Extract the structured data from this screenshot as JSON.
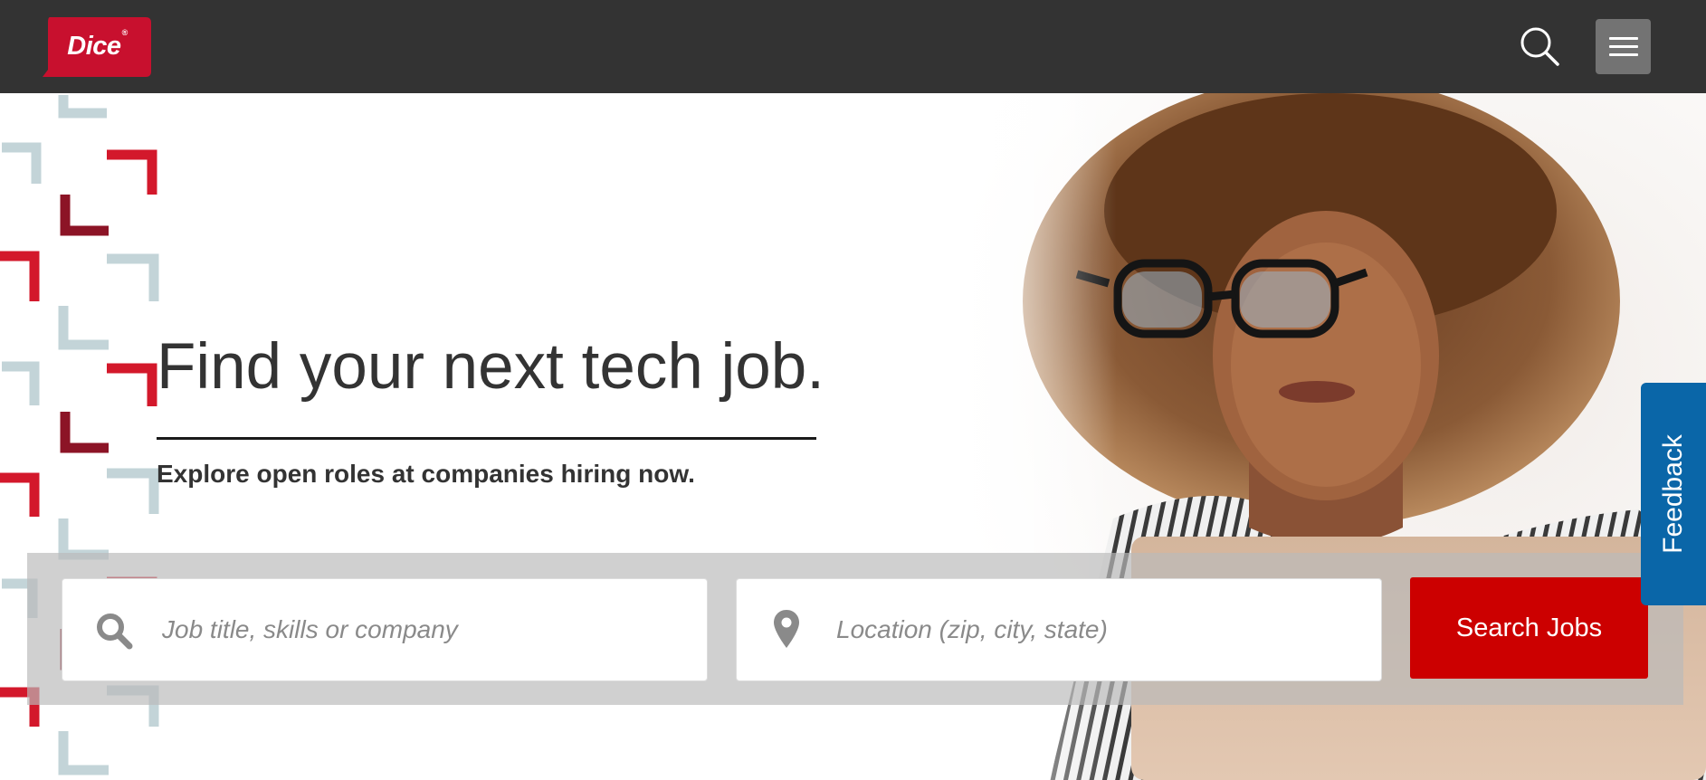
{
  "brand": {
    "logo_text": "Dice",
    "logo_mark": "®",
    "color": "#c8102e"
  },
  "nav": {
    "search_icon": "search-icon",
    "menu_icon": "hamburger-menu-icon"
  },
  "hero": {
    "headline": "Find your next tech job.",
    "subheadline": "Explore open roles at companies hiring now."
  },
  "search": {
    "job_placeholder": "Job title, skills or company",
    "job_icon": "search-icon",
    "location_placeholder": "Location (zip, city, state)",
    "location_icon": "map-pin-icon",
    "button_label": "Search Jobs",
    "button_color": "#cc0000"
  },
  "feedback": {
    "label": "Feedback",
    "color": "#0a66a8"
  },
  "colors": {
    "topbar": "#333333",
    "pattern_red": "#d3182b",
    "pattern_dark_red": "#8c1426",
    "pattern_light": "#c3d4d8"
  }
}
